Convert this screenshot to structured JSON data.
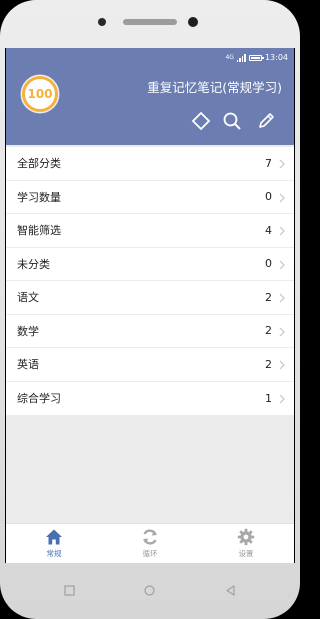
{
  "status_bar": {
    "network": "4G",
    "time": "13:04"
  },
  "header": {
    "progress_value": "100",
    "title": "重复记忆笔记(常规学习)",
    "icons": [
      "tag-icon",
      "search-icon",
      "edit-icon"
    ]
  },
  "categories": [
    {
      "label": "全部分类",
      "count": "7"
    },
    {
      "label": "学习数量",
      "count": "0"
    },
    {
      "label": "智能筛选",
      "count": "4"
    },
    {
      "label": "未分类",
      "count": "0"
    },
    {
      "label": "语文",
      "count": "2"
    },
    {
      "label": "数学",
      "count": "2"
    },
    {
      "label": "英语",
      "count": "2"
    },
    {
      "label": "综合学习",
      "count": "1"
    }
  ],
  "tabs": [
    {
      "label": "常规",
      "icon": "home-icon",
      "active": true
    },
    {
      "label": "循环",
      "icon": "cycle-icon",
      "active": false
    },
    {
      "label": "设置",
      "icon": "gear-icon",
      "active": false
    }
  ],
  "colors": {
    "header_bg": "#6c7db2",
    "accent_orange": "#f5b23a",
    "tab_active": "#4a6fb0",
    "tab_inactive": "#9b9b9b"
  }
}
